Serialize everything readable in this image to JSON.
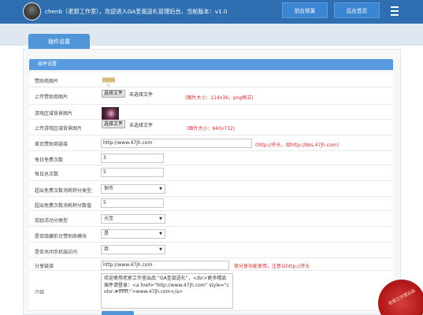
{
  "header": {
    "username": "chenb（老郭工作室）",
    "welcome_text": "chenb（老郭工作室），欢迎进入GA圣诞送礼管理后台，当前版本：v1.0",
    "front_button": "前台效果",
    "home_button": "后台首页"
  },
  "tab": {
    "label": "插件设置"
  },
  "panel": {
    "title": "插件设置"
  },
  "form": {
    "sponsor_image_label": "赞助商图片",
    "sponsor_image_thumb": "赞助商图片",
    "upload_sponsor_label": "上传赞助商图片",
    "upload_sponsor_button": "选择文件",
    "upload_sponsor_status": "未选择文件",
    "upload_sponsor_hint": "(图片大小：114x36，png格式)",
    "game_bg_label": "游戏区域背景图片",
    "upload_game_bg_label": "上传游戏区域背景图片",
    "upload_game_bg_button": "选择文件",
    "upload_game_bg_status": "未选择文件",
    "upload_game_bg_hint": "(图片大小：940x732)",
    "home_sponsor_link_label": "首页赞助商链接",
    "home_sponsor_link_value": "http://www.47jh.com",
    "home_sponsor_link_hint": "(http://开头，如http://bbs.47jh.com)",
    "daily_free_label": "每日免费次数",
    "daily_free_value": "3",
    "daily_total_label": "每日总次数",
    "daily_total_value": "5",
    "over_type_label": "超出免费次数消耗积分类型",
    "over_type_value": "铜币",
    "over_value_label": "超出免费次数消耗积分数值",
    "over_value_value": "5",
    "reward_type_label": "奖励活动分类型",
    "reward_type_value": "元宝",
    "show_module_label": "是否隐藏前台赞助商模块",
    "show_module_value": "是",
    "mobile_label": "是否关闭手机端访问",
    "mobile_value": "否",
    "share_link_label": "分享链接",
    "share_link_value": "http://www.47jh.com",
    "share_link_hint": "供分享功能使用，注意以http://开头",
    "intro_label": "介绍",
    "intro_value": "欢迎使用老郭工作室出品 “GA圣诞送礼”，</br>更多精品插件请登录：<a href=\"http://www.47jh.com\" style=\"color:#ffffff;\">www.47jh.com</a>"
  },
  "stamp": {
    "text": "老郭工作室出品"
  },
  "colors": {
    "header": "#2f6fb1",
    "accent": "#4f95d8",
    "hint": "#d02a2a"
  }
}
